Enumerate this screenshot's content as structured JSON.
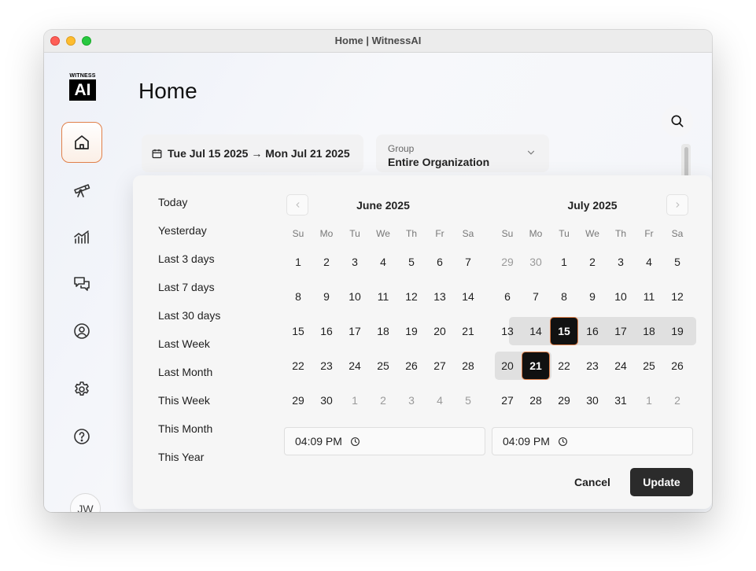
{
  "window": {
    "title": "Home | WitnessAI"
  },
  "logo": {
    "top_text": "WITNESS",
    "mark_text": "AI"
  },
  "sidebar": {
    "items": [
      {
        "name": "home",
        "icon": "home-icon",
        "active": true
      },
      {
        "name": "discover",
        "icon": "telescope-icon",
        "active": false
      },
      {
        "name": "analytics",
        "icon": "chart-icon",
        "active": false
      },
      {
        "name": "conversations",
        "icon": "chat-icon",
        "active": false
      },
      {
        "name": "users",
        "icon": "user-circle-icon",
        "active": false
      },
      {
        "name": "settings",
        "icon": "gear-icon",
        "active": false
      },
      {
        "name": "help",
        "icon": "help-icon",
        "active": false
      }
    ],
    "avatar_initials": "JW"
  },
  "page": {
    "title": "Home"
  },
  "filters": {
    "date_range": "Tue Jul 15 2025 → Mon Jul 21 2025",
    "group_label": "Group",
    "group_value": "Entire Organization"
  },
  "picker": {
    "presets": [
      "Today",
      "Yesterday",
      "Last 3 days",
      "Last 7 days",
      "Last 30 days",
      "Last Week",
      "Last Month",
      "This Week",
      "This Month",
      "This Year"
    ],
    "weekdays": [
      "Su",
      "Mo",
      "Tu",
      "We",
      "Th",
      "Fr",
      "Sa"
    ],
    "months": [
      {
        "title": "June 2025",
        "weeks": [
          [
            {
              "d": "1"
            },
            {
              "d": "2"
            },
            {
              "d": "3"
            },
            {
              "d": "4"
            },
            {
              "d": "5"
            },
            {
              "d": "6"
            },
            {
              "d": "7"
            }
          ],
          [
            {
              "d": "8"
            },
            {
              "d": "9"
            },
            {
              "d": "10"
            },
            {
              "d": "11"
            },
            {
              "d": "12"
            },
            {
              "d": "13"
            },
            {
              "d": "14"
            }
          ],
          [
            {
              "d": "15"
            },
            {
              "d": "16"
            },
            {
              "d": "17"
            },
            {
              "d": "18"
            },
            {
              "d": "19"
            },
            {
              "d": "20"
            },
            {
              "d": "21"
            }
          ],
          [
            {
              "d": "22"
            },
            {
              "d": "23"
            },
            {
              "d": "24"
            },
            {
              "d": "25"
            },
            {
              "d": "26"
            },
            {
              "d": "27"
            },
            {
              "d": "28"
            }
          ],
          [
            {
              "d": "29"
            },
            {
              "d": "30"
            },
            {
              "d": "1",
              "m": true
            },
            {
              "d": "2",
              "m": true
            },
            {
              "d": "3",
              "m": true
            },
            {
              "d": "4",
              "m": true
            },
            {
              "d": "5",
              "m": true
            }
          ]
        ]
      },
      {
        "title": "July 2025",
        "weeks": [
          [
            {
              "d": "29",
              "m": true
            },
            {
              "d": "30",
              "m": true
            },
            {
              "d": "1"
            },
            {
              "d": "2"
            },
            {
              "d": "3"
            },
            {
              "d": "4"
            },
            {
              "d": "5"
            }
          ],
          [
            {
              "d": "6"
            },
            {
              "d": "7"
            },
            {
              "d": "8"
            },
            {
              "d": "9"
            },
            {
              "d": "10"
            },
            {
              "d": "11"
            },
            {
              "d": "12"
            }
          ],
          [
            {
              "d": "13"
            },
            {
              "d": "14"
            },
            {
              "d": "15",
              "sel": true
            },
            {
              "d": "16",
              "r": true
            },
            {
              "d": "17",
              "r": true
            },
            {
              "d": "18",
              "r": true
            },
            {
              "d": "19",
              "r": true
            }
          ],
          [
            {
              "d": "20",
              "r": true
            },
            {
              "d": "21",
              "sel": true
            },
            {
              "d": "22"
            },
            {
              "d": "23"
            },
            {
              "d": "24"
            },
            {
              "d": "25"
            },
            {
              "d": "26"
            }
          ],
          [
            {
              "d": "27"
            },
            {
              "d": "28"
            },
            {
              "d": "29"
            },
            {
              "d": "30"
            },
            {
              "d": "31"
            },
            {
              "d": "1",
              "m": true
            },
            {
              "d": "2",
              "m": true
            }
          ]
        ]
      }
    ],
    "start_time": "04:09 PM",
    "end_time": "04:09 PM",
    "cancel_label": "Cancel",
    "update_label": "Update"
  },
  "colors": {
    "accent": "#e0804a",
    "selected_bg": "#111111",
    "range_bg": "#e0e0e0",
    "primary_button": "#2b2b2b"
  }
}
